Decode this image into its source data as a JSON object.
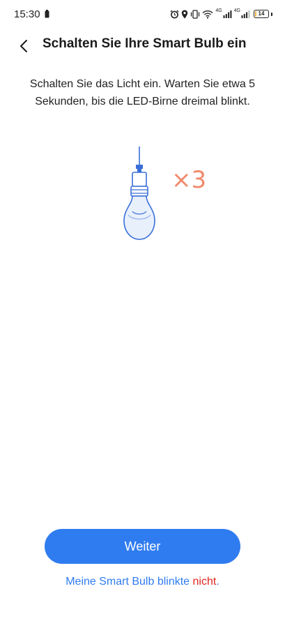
{
  "status_bar": {
    "time": "15:30",
    "network_labels": [
      "4G",
      "4G"
    ],
    "battery_level": "14",
    "battery_fraction": 0.14,
    "icons": [
      "battery-saver-icon",
      "alarm-icon",
      "location-icon",
      "vibrate-icon",
      "wifi-icon",
      "signal-icon",
      "signal-icon",
      "battery-icon"
    ]
  },
  "header": {
    "back_icon": "chevron-left-icon",
    "title": "Schalten Sie Ihre Smart Bulb ein"
  },
  "instruction": {
    "text": "Schalten Sie das Licht ein. Warten Sie etwa 5 Sekunden, bis die LED-Birne dreimal blinkt."
  },
  "illustration": {
    "icon": "light-bulb-icon",
    "blink_count": "×3",
    "bulb_color": "#3a6fd8",
    "bulb_fill": "#e8f0fc",
    "count_color": "#f08a6c"
  },
  "actions": {
    "next_label": "Weiter",
    "not_blinked_text": "Meine Smart Bulb blinkte ",
    "not_blinked_emphasis": "nicht",
    "not_blinked_tail": "."
  },
  "colors": {
    "accent": "#2f7cf0",
    "emphasis": "#e0261e",
    "battery_low": "#f2b73f"
  }
}
